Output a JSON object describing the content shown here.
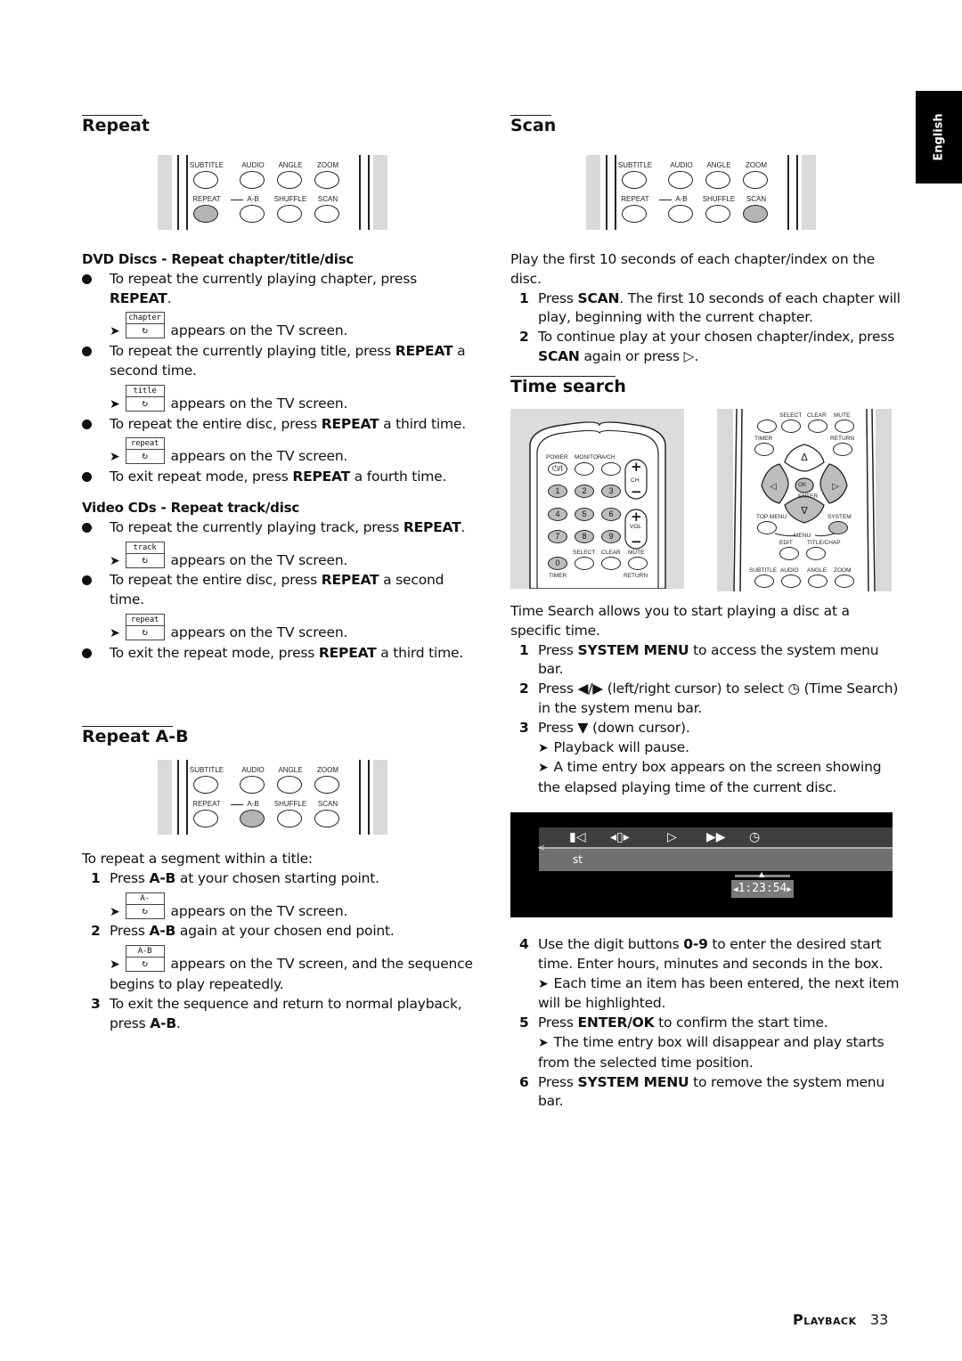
{
  "language_tab": "English",
  "remote_strip": {
    "top_labels": [
      "SUBTITLE",
      "AUDIO",
      "ANGLE",
      "ZOOM"
    ],
    "bottom_labels": [
      "REPEAT",
      "A-B",
      "SHUFFLE",
      "SCAN"
    ],
    "highlight_color": "#b4b4b4"
  },
  "left": {
    "repeat": {
      "title": "Repeat",
      "highlighted_button": "REPEAT",
      "dvd_heading": "DVD Discs - Repeat chapter/title/disc",
      "dvd_items": [
        {
          "text_pre": "To repeat the currently playing chapter, press ",
          "bold": "REPEAT",
          "text_post": ".",
          "osd_label": "chapter",
          "result": "appears on the TV screen."
        },
        {
          "text_pre": "To repeat the currently playing title, press ",
          "bold": "REPEAT",
          "text_post": " a second time.",
          "osd_label": "title",
          "result": "appears on the TV screen."
        },
        {
          "text_pre": "To repeat the entire disc, press ",
          "bold": "REPEAT",
          "text_post": " a third time.",
          "osd_label": "repeat",
          "result": "appears on the TV screen."
        },
        {
          "text_pre": "To exit repeat mode, press ",
          "bold": "REPEAT",
          "text_post": " a fourth time."
        }
      ],
      "vcd_heading": "Video CDs - Repeat track/disc",
      "vcd_items": [
        {
          "text_pre": "To repeat the currently playing track, press ",
          "bold": "REPEAT",
          "text_post": ".",
          "osd_label": "track",
          "result": "appears on the TV screen."
        },
        {
          "text_pre": "To repeat the entire disc, press ",
          "bold": "REPEAT",
          "text_post": " a second time.",
          "osd_label": "repeat",
          "result": "appears on the TV screen."
        },
        {
          "text_pre": "To exit the repeat mode, press ",
          "bold": "REPEAT",
          "text_post": " a third time."
        }
      ]
    },
    "repeat_ab": {
      "title": "Repeat A-B",
      "highlighted_button": "A-B",
      "intro": "To repeat a segment within a title:",
      "steps": [
        {
          "num": "1",
          "text_pre": "Press ",
          "bold": "A-B",
          "text_post": " at your chosen starting point.",
          "osd_label": "A-",
          "result": "appears on the TV screen."
        },
        {
          "num": "2",
          "text_pre": "Press ",
          "bold": "A-B",
          "text_post": " again at your chosen end point.",
          "osd_label": "A-B",
          "result": "appears on the TV screen, and the sequence begins to play repeatedly."
        },
        {
          "num": "3",
          "text_pre": "To exit the sequence and return to normal playback, press ",
          "bold": "A-B",
          "text_post": "."
        }
      ]
    }
  },
  "right": {
    "scan": {
      "title": "Scan",
      "highlighted_button": "SCAN",
      "intro": "Play the first 10 seconds of each chapter/index on the disc.",
      "steps": [
        {
          "num": "1",
          "text_pre": "Press ",
          "bold": "SCAN",
          "text_post": ". The first 10 seconds of each chapter will play, beginning with the current chapter."
        },
        {
          "num": "2",
          "text_pre": "To continue play at your chosen chapter/index, press ",
          "bold": "SCAN",
          "text_post": " again or press ▷."
        }
      ]
    },
    "time_search": {
      "title": "Time search",
      "remote1": {
        "labels": [
          "POWER",
          "MONITOR",
          "A/CH",
          "CH",
          "VOL",
          "SELECT",
          "CLEAR",
          "MUTE",
          "TIMER",
          "RETURN"
        ],
        "digits": [
          "1",
          "2",
          "3",
          "4",
          "5",
          "6",
          "7",
          "8",
          "9",
          "0"
        ],
        "power_symbol": "⏻/I"
      },
      "remote2": {
        "labels": [
          "SELECT",
          "CLEAR",
          "MUTE",
          "TIMER",
          "RETURN",
          "OK",
          "ENTER",
          "TOP MENU",
          "SYSTEM",
          "MENU",
          "EDIT",
          "TITLE/CHAP",
          "SUBTITLE",
          "AUDIO",
          "ANGLE",
          "ZOOM"
        ]
      },
      "intro": "Time Search allows you to start playing a disc at a specific time.",
      "steps": [
        {
          "num": "1",
          "text_pre": "Press ",
          "bold": "SYSTEM MENU",
          "text_post": " to access the system menu bar."
        },
        {
          "num": "2",
          "text_pre": "Press ◀/▶ (left/right cursor) to select ◷  (Time Search) in the system menu bar."
        },
        {
          "num": "3",
          "text_pre": "Press ▼ (down cursor).",
          "results": [
            "Playback will pause.",
            "A time entry box appears on the screen showing the elapsed playing time of the current disc."
          ]
        }
      ],
      "osd": {
        "menu_text": "st",
        "time_value": "1:23:54"
      },
      "steps2": [
        {
          "num": "4",
          "text_pre": "Use the digit buttons ",
          "bold": "0-9",
          "text_post": " to enter the desired start time. Enter hours, minutes and seconds in the box.",
          "result": "Each time an item has been entered, the next item will be highlighted."
        },
        {
          "num": "5",
          "text_pre": "Press ",
          "bold": "ENTER/OK",
          "text_post": " to confirm the start time.",
          "result": "The time entry box will disappear and play starts from the selected time position."
        },
        {
          "num": "6",
          "text_pre": "Press ",
          "bold": "SYSTEM MENU",
          "text_post": " to remove the system menu bar."
        }
      ]
    }
  },
  "footer": {
    "section": "Playback",
    "page": "33"
  }
}
